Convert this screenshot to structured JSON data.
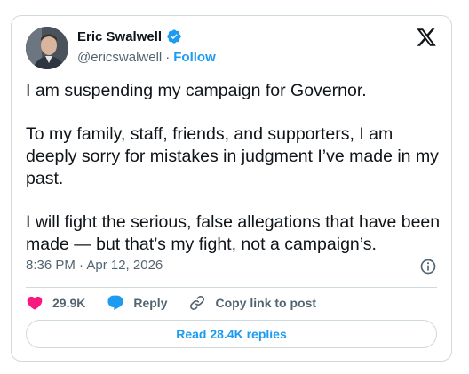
{
  "author": {
    "name": "Eric Swalwell",
    "handle": "@ericswalwell",
    "separator": "·",
    "follow_label": "Follow",
    "verified_icon": "verified-badge-icon",
    "avatar_icon": "avatar-photo"
  },
  "brand": {
    "logo_icon": "x-logo-icon"
  },
  "tweet": {
    "paragraphs": [
      "I am suspending my campaign for Governor.",
      "To my family, staff, friends, and supporters, I am deeply sorry for mistakes in judgment I’ve made in my past.",
      "I will fight the serious, false allegations that have been made — but that’s my fight, not a campaign’s."
    ],
    "timestamp": "8:36 PM · Apr 12, 2026",
    "info_icon": "info-icon"
  },
  "actions": {
    "like": {
      "icon": "heart-icon",
      "count": "29.9K"
    },
    "reply": {
      "icon": "reply-bubble-icon",
      "label": "Reply"
    },
    "copy": {
      "icon": "link-icon",
      "label": "Copy link to post"
    }
  },
  "replies_button": {
    "label": "Read 28.4K replies"
  },
  "colors": {
    "accent": "#1d9bf0",
    "heart": "#f91880",
    "text": "#0f1419",
    "muted": "#536471",
    "border": "#cfd9de"
  }
}
